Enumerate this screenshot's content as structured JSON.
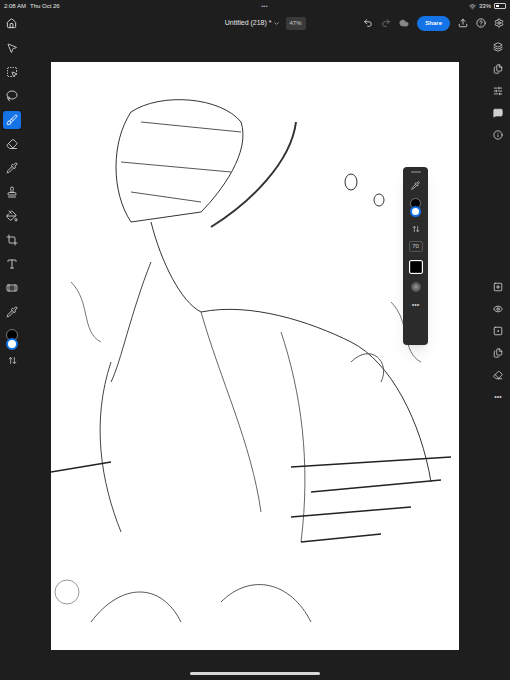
{
  "status_bar": {
    "time": "2:08 AM",
    "date": "Thu Oct 26",
    "multitask": "•••",
    "battery": "33%",
    "battery_level": 0.33
  },
  "top_bar": {
    "title": "Untitled (218) *",
    "zoom": "47%",
    "share": "Share"
  },
  "tools": [
    {
      "kind": "select",
      "selected": false
    },
    {
      "kind": "transform",
      "selected": false
    },
    {
      "kind": "lasso",
      "selected": false
    },
    {
      "kind": "brush",
      "selected": true
    },
    {
      "kind": "eraser",
      "selected": false
    },
    {
      "kind": "dropper",
      "selected": false
    },
    {
      "kind": "stamp",
      "selected": false
    },
    {
      "kind": "fill",
      "selected": false
    },
    {
      "kind": "crop",
      "selected": false
    },
    {
      "kind": "text",
      "selected": false
    },
    {
      "kind": "heal",
      "selected": false
    },
    {
      "kind": "sampler",
      "selected": false
    }
  ],
  "colors": {
    "foreground": "#000000",
    "background": "#ffffff"
  },
  "brush_panel": {
    "size": "70",
    "more": "•••"
  },
  "layer_actions": {
    "more": "•••"
  }
}
